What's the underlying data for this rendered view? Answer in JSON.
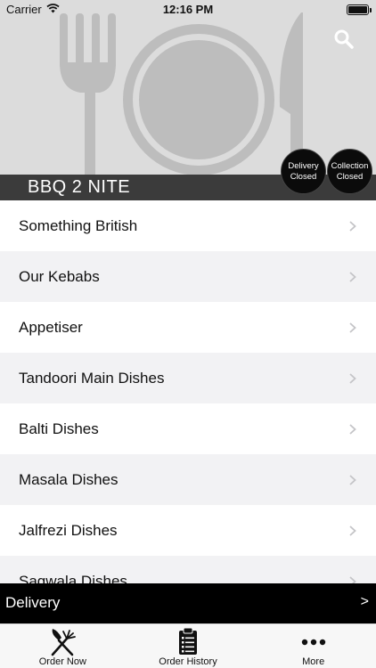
{
  "status_bar": {
    "carrier": "Carrier",
    "time": "12:16 PM"
  },
  "header": {
    "restaurant_name": "BBQ 2 NITE",
    "delivery_badge": {
      "line1": "Delivery",
      "line2": "Closed"
    },
    "collection_badge": {
      "line1": "Collection",
      "line2": "Closed"
    },
    "search_icon": "search-icon",
    "background_art": "plate-cutlery-icon"
  },
  "categories": [
    {
      "label": "Something British"
    },
    {
      "label": "Our Kebabs"
    },
    {
      "label": "Appetiser"
    },
    {
      "label": "Tandoori Main Dishes"
    },
    {
      "label": "Balti Dishes"
    },
    {
      "label": "Masala Dishes"
    },
    {
      "label": "Jalfrezi Dishes"
    },
    {
      "label": "Sagwala Dishes"
    }
  ],
  "delivery_bar": {
    "label": "Delivery",
    "arrow": ">"
  },
  "tabs": [
    {
      "label": "Order Now",
      "icon": "fork-knife-icon"
    },
    {
      "label": "Order History",
      "icon": "clipboard-list-icon"
    },
    {
      "label": "More",
      "icon": "more-dots-icon"
    }
  ],
  "colors": {
    "header_bg": "#dcdcdc",
    "title_bar_bg": "#3b3b3b",
    "badge_bg": "#0b0b0b",
    "delivery_bar_bg": "#000000",
    "row_alt_bg": "#f2f2f4"
  }
}
